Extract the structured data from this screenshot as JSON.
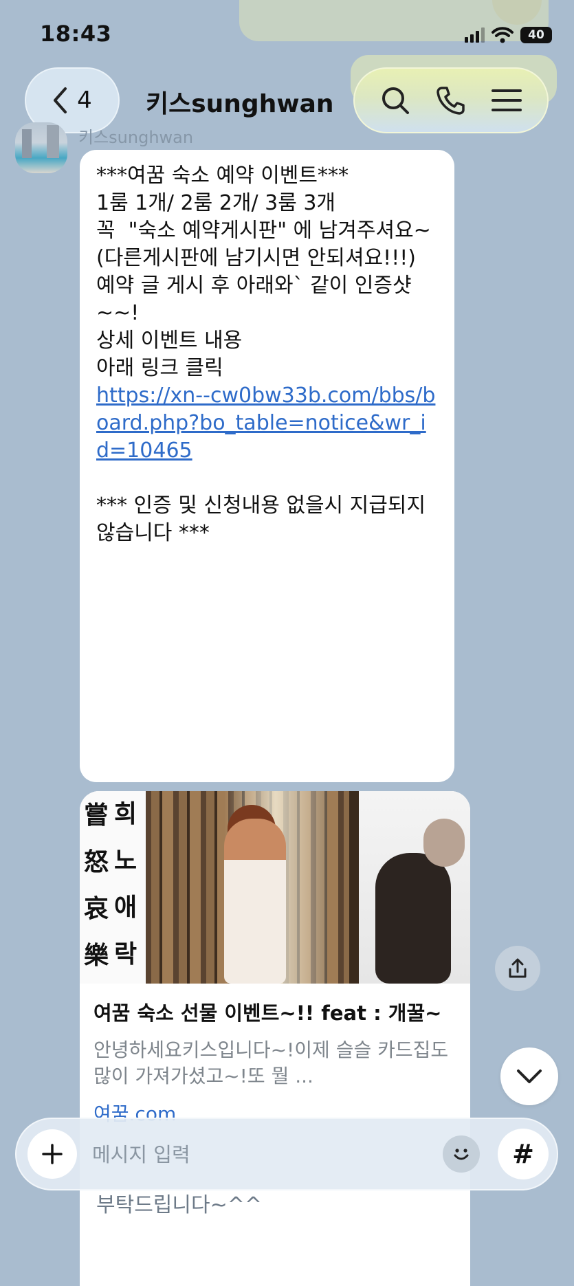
{
  "status_bar": {
    "time": "18:43",
    "battery": "40"
  },
  "header": {
    "back_count": "4",
    "title": "키스sunghwan"
  },
  "message": {
    "sender": "키스sunghwan",
    "lines": [
      "***여꿈 숙소 예약 이벤트***",
      "",
      "",
      "1룸 1개/ 2룸 2개/ 3룸 3개",
      "",
      "꼭  \"숙소 예약게시판\" 에 남겨주셔요~\n(다른게시판에 남기시면 안되셔요!!!)",
      "",
      "예약 글 게시 후 아래와` 같이 인증샷\n~~!",
      "",
      "상세 이벤트 내용",
      "",
      "아래 링크 클릭",
      ""
    ],
    "link": "https://xn--cw0bw33b.com/bbs/board.php?bo_table=notice&wr_id=10465",
    "footer": "*** 인증 및 신청내용 없을시 지급되지\n않습니다 ***"
  },
  "link_card": {
    "calligraphy_left": [
      "嘗",
      "怒",
      "哀",
      "樂"
    ],
    "calligraphy_right": [
      "희",
      "노",
      "애",
      "락"
    ],
    "title": "여꿈 숙소 선물 이벤트~!! feat : 개꿀~",
    "description": "안녕하세요키스입니다~!이제 슬슬 카드집도 많이 가져가셨고~!또 뭘 ...",
    "domain": "여꿈.com"
  },
  "composer": {
    "placeholder": "메시지 입력",
    "hash": "#"
  },
  "background_text": "부탁드립니다~^^",
  "colors": {
    "background": "#a9bccf",
    "link": "#2e6bc9",
    "actions_pill": "#e8f0b4"
  }
}
